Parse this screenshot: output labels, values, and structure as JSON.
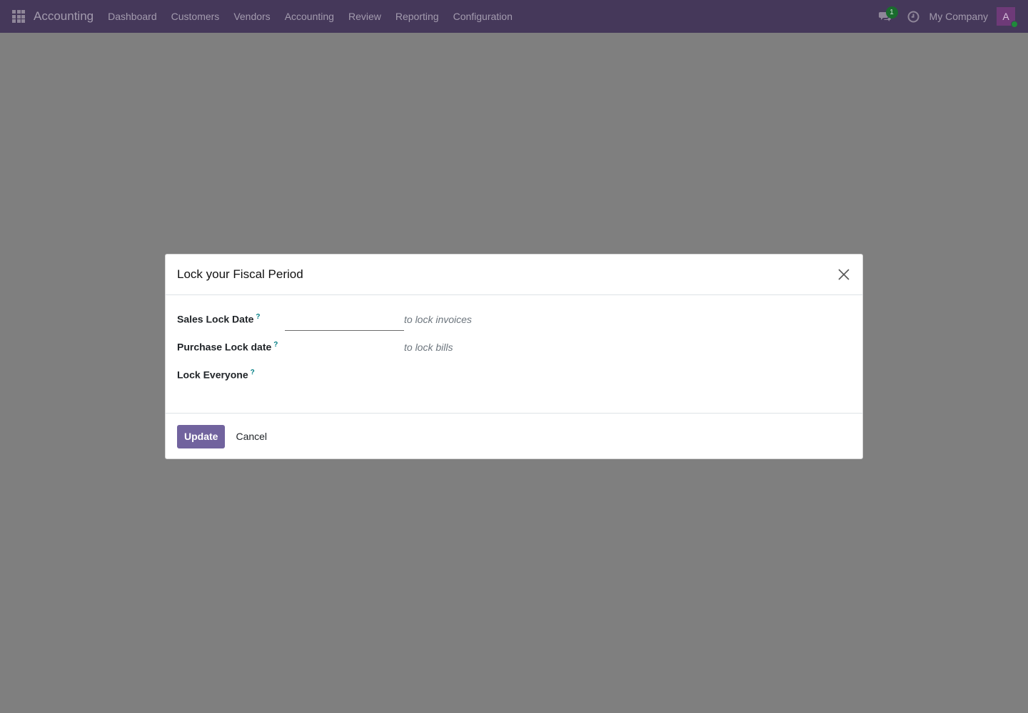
{
  "navbar": {
    "brand": "Accounting",
    "menu": [
      {
        "label": "Dashboard"
      },
      {
        "label": "Customers"
      },
      {
        "label": "Vendors"
      },
      {
        "label": "Accounting"
      },
      {
        "label": "Review"
      },
      {
        "label": "Reporting"
      },
      {
        "label": "Configuration"
      }
    ],
    "messages_badge": "1",
    "company": "My Company",
    "avatar_letter": "A"
  },
  "dialog": {
    "title": "Lock your Fiscal Period",
    "help_mark": "?",
    "fields": [
      {
        "label": "Sales Lock Date",
        "value": "",
        "hint": "to lock invoices"
      },
      {
        "label": "Purchase Lock date",
        "value": "",
        "hint": "to lock bills"
      },
      {
        "label": "Lock Everyone",
        "value": "",
        "hint": ""
      }
    ],
    "update_label": "Update",
    "cancel_label": "Cancel"
  },
  "colors": {
    "navbar_bg": "#45385a",
    "primary": "#71639e",
    "help": "#017e84",
    "backdrop": "#7f7f7f"
  },
  "icons": [
    "apps-grid-icon",
    "chat-icon",
    "clock-icon",
    "close-icon"
  ]
}
